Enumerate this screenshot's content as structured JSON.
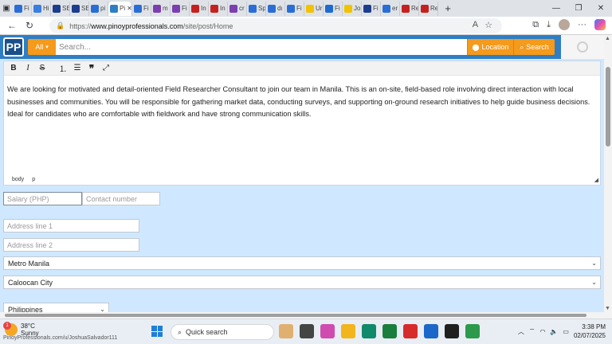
{
  "browser": {
    "tabs": [
      {
        "label": "Fi",
        "color": "#2b6dd6"
      },
      {
        "label": "Hi",
        "color": "#3b7de0"
      },
      {
        "label": "SE",
        "color": "#1c3d8f"
      },
      {
        "label": "SE",
        "color": "#1c3d8f"
      },
      {
        "label": "pi",
        "color": "#2b6dd6"
      },
      {
        "label": "Pi",
        "color": "#2f7ec4",
        "active": true
      },
      {
        "label": "Fi",
        "color": "#2b6dd6"
      },
      {
        "label": "m",
        "color": "#7b3fb0"
      },
      {
        "label": "Fi",
        "color": "#7b3fb0"
      },
      {
        "label": "In",
        "color": "#c5221f"
      },
      {
        "label": "In",
        "color": "#c5221f"
      },
      {
        "label": "cr",
        "color": "#7b3fb0"
      },
      {
        "label": "Sp",
        "color": "#2b6dd6"
      },
      {
        "label": "dı",
        "color": "#2b6dd6"
      },
      {
        "label": "Fi",
        "color": "#2b6dd6"
      },
      {
        "label": "Ur",
        "color": "#f2c200"
      },
      {
        "label": "Fi",
        "color": "#1c6bd1"
      },
      {
        "label": "Jo",
        "color": "#f2c200"
      },
      {
        "label": "Fi",
        "color": "#1c3d8f"
      },
      {
        "label": "er",
        "color": "#2b6dd6"
      },
      {
        "label": "Re",
        "color": "#c5221f"
      },
      {
        "label": "Re",
        "color": "#c5221f"
      }
    ],
    "url": {
      "scheme": "https://",
      "host": "www.pinoyprofessionals.com",
      "path": "/site/post/Home"
    }
  },
  "header": {
    "logo_text": "PP",
    "all_label": "All",
    "search_placeholder": "Search...",
    "location_label": "Location",
    "search_button_label": "Search"
  },
  "editor": {
    "toolbar": [
      "B",
      "I",
      "S",
      "ordered-list",
      "unordered-list",
      "quote",
      "fullscreen"
    ],
    "body": "We are looking for motivated and detail-oriented Field Researcher Consultant to join our team in Manila. This is an on-site, field-based role involving direct interaction with local businesses and communities. You will be responsible for gathering market data, conducting surveys, and supporting on-ground research initiatives to help guide business decisions. Ideal for candidates who are comfortable with fieldwork and have strong communication skills.",
    "status_path": [
      "body",
      "p"
    ]
  },
  "form": {
    "salary_placeholder": "Salary (PHP)",
    "contact_placeholder": "Contact number",
    "address1_placeholder": "Address line 1",
    "address2_placeholder": "Address line 2",
    "region": "Metro Manila",
    "city": "Caloocan City",
    "country": "Philippines"
  },
  "taskbar": {
    "temperature": "38°C",
    "weather": "Sunny",
    "watermark": "PinoyProfessionals.com/u/JoshuaSalvador111",
    "search_label": "Quick search",
    "badge": "1",
    "time": "3:38 PM",
    "date": "02/07/2025",
    "app_colors": [
      "#e0b070",
      "#444444",
      "#d04bb0",
      "#f2b51c",
      "#0f8a6a",
      "#1a7f3c",
      "#d72b2b",
      "#1b66c9",
      "#1f1f1f",
      "#2c9a4a"
    ]
  }
}
